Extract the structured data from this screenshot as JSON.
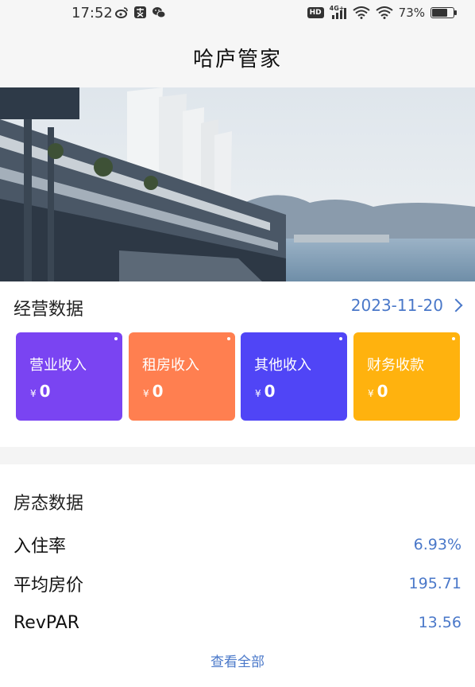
{
  "status_bar": {
    "time": "17:52",
    "battery": "73%",
    "network_label": "4G+",
    "hd_label": "HD",
    "battery_level": 0.73,
    "icons": [
      "weibo-icon",
      "app-icon",
      "wechat-icon",
      "hd-icon",
      "signal-icon",
      "wifi-icon",
      "wifi-icon",
      "battery-icon"
    ]
  },
  "header": {
    "title": "哈庐管家"
  },
  "business": {
    "title": "经营数据",
    "date": "2023-11-20",
    "cards": [
      {
        "label": "营业收入",
        "currency": "¥",
        "value": "0",
        "color": "#7a44f2"
      },
      {
        "label": "租房收入",
        "currency": "¥",
        "value": "0",
        "color": "#ff7f50"
      },
      {
        "label": "其他收入",
        "currency": "¥",
        "value": "0",
        "color": "#5045f6"
      },
      {
        "label": "财务收款",
        "currency": "¥",
        "value": "0",
        "color": "#ffb20e"
      }
    ]
  },
  "room": {
    "title": "房态数据",
    "rows": [
      {
        "label": "入住率",
        "value": "6.93%"
      },
      {
        "label": "平均房价",
        "value": "195.71"
      },
      {
        "label": "RevPAR",
        "value": "13.56"
      }
    ],
    "view_all": "查看全部"
  },
  "colors": {
    "accent": "#4a78c9",
    "background": "#f6f6f6"
  }
}
